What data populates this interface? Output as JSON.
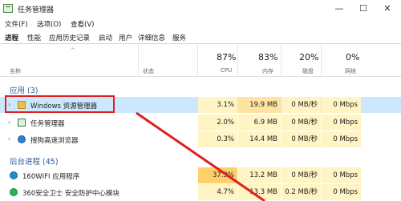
{
  "window": {
    "title": "任务管理器",
    "minimize": "—",
    "maximize": "☐",
    "close": "✕"
  },
  "menu": [
    "文件(F)",
    "选项(O)",
    "查看(V)"
  ],
  "tabs": [
    "进程",
    "性能",
    "应用历史记录",
    "启动",
    "用户",
    "详细信息",
    "服务"
  ],
  "columns": {
    "name": "名称",
    "status": "状态",
    "cpu": {
      "pct": "87%",
      "label": "CPU"
    },
    "memory": {
      "pct": "83%",
      "label": "内存"
    },
    "disk": {
      "pct": "20%",
      "label": "磁盘"
    },
    "network": {
      "pct": "0%",
      "label": "网络"
    }
  },
  "groups": {
    "apps": "应用 (3)",
    "background": "后台进程 (45)"
  },
  "apps": [
    {
      "name": "Windows 资源管理器",
      "cpu": "3.1%",
      "memory": "19.9 MB",
      "disk": "0 MB/秒",
      "network": "0 Mbps"
    },
    {
      "name": "任务管理器",
      "cpu": "2.0%",
      "memory": "6.9 MB",
      "disk": "0 MB/秒",
      "network": "0 Mbps"
    },
    {
      "name": "搜狗高速浏览器",
      "cpu": "0.3%",
      "memory": "14.4 MB",
      "disk": "0 MB/秒",
      "network": "0 Mbps"
    }
  ],
  "background": [
    {
      "name": "160WIFI 应用程序",
      "cpu": "37.9%",
      "memory": "13.2 MB",
      "disk": "0 MB/秒",
      "network": "0 Mbps"
    },
    {
      "name": "360安全卫士 安全防护中心模块",
      "cpu": "4.7%",
      "memory": "13.3 MB",
      "disk": "0.2 MB/秒",
      "network": "0 Mbps"
    }
  ],
  "colors": {
    "selection": "#cce8ff",
    "highlight_box": "#e02020",
    "group_text": "#2a5a9a"
  }
}
